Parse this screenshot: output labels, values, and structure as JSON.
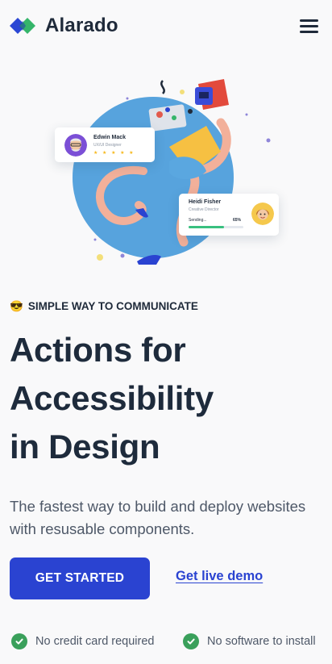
{
  "header": {
    "brand": "Alarado",
    "logo_icon": "diamond-logo-icon",
    "menu_icon": "hamburger-menu-icon"
  },
  "hero_illustration": {
    "profile_card": {
      "name": "Edwin Mack",
      "role": "UX/UI Designer",
      "rating_stars": "★ ★ ★ ★ ★",
      "rating": 5
    },
    "upload_card": {
      "name": "Heidi Fisher",
      "role": "Creative Director",
      "status": "Sending...",
      "progress_label": "65%",
      "progress": 0.65
    }
  },
  "eyebrow": {
    "emoji": "😎",
    "text": "SIMPLE WAY TO COMMUNICATE"
  },
  "headline": {
    "lines": [
      "Actions for",
      "Accessibility",
      "in Design"
    ]
  },
  "subtitle": "The fastest way to build and deploy websites with resusable components.",
  "cta": {
    "primary": "GET STARTED",
    "secondary": "Get live demo"
  },
  "features": [
    {
      "icon": "check-circle-icon",
      "label": "No credit card required"
    },
    {
      "icon": "check-circle-icon",
      "label": "No software to install"
    }
  ],
  "colors": {
    "accent": "#2a43d1",
    "logo_blue": "#2b47d4",
    "logo_green": "#35b56a",
    "check_green": "#3aa05b",
    "heading": "#1e2b3c",
    "background": "#f9f9fa"
  }
}
